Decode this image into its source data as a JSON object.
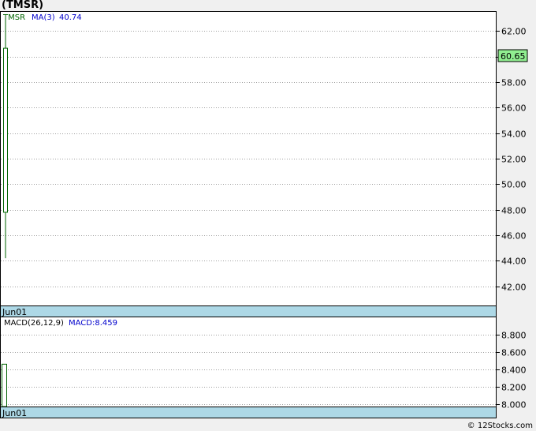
{
  "title": "(TMSR)",
  "credit": "© 12Stocks.com",
  "colors": {
    "up": "#006400",
    "grid": "#a0a0a0",
    "date_band": "#add8e6",
    "ma_text": "#0000cc",
    "last_price_bg": "#90ee90",
    "plot_bg": "#ffffff",
    "page_bg": "#f0f0f0"
  },
  "chart_data": [
    {
      "type": "candlestick",
      "panel": "price",
      "legend": {
        "symbol": "TMSR",
        "ma_label": "MA(3)",
        "ma_value": "40.74"
      },
      "last_price": "60.65",
      "ylim": [
        40.5,
        63.5
      ],
      "yticks": [
        "42.00",
        "44.00",
        "46.00",
        "48.00",
        "50.00",
        "52.00",
        "54.00",
        "56.00",
        "58.00",
        "60.00",
        "62.00"
      ],
      "x_labels": [
        "Jun01"
      ],
      "candles": [
        {
          "date": "Jun01",
          "open": 47.8,
          "close": 60.65,
          "high": 63.0,
          "low": 44.2
        }
      ],
      "grid": true
    },
    {
      "type": "bar",
      "panel": "macd",
      "legend": {
        "label": "MACD(26,12,9)",
        "macd_label": "MACD:8.459"
      },
      "ylim": [
        7.97,
        9.0
      ],
      "yticks": [
        "8.000",
        "8.200",
        "8.400",
        "8.600",
        "8.800"
      ],
      "x_labels": [
        "Jun01"
      ],
      "bars": [
        {
          "date": "Jun01",
          "value": 8.459
        }
      ],
      "grid": true
    }
  ]
}
